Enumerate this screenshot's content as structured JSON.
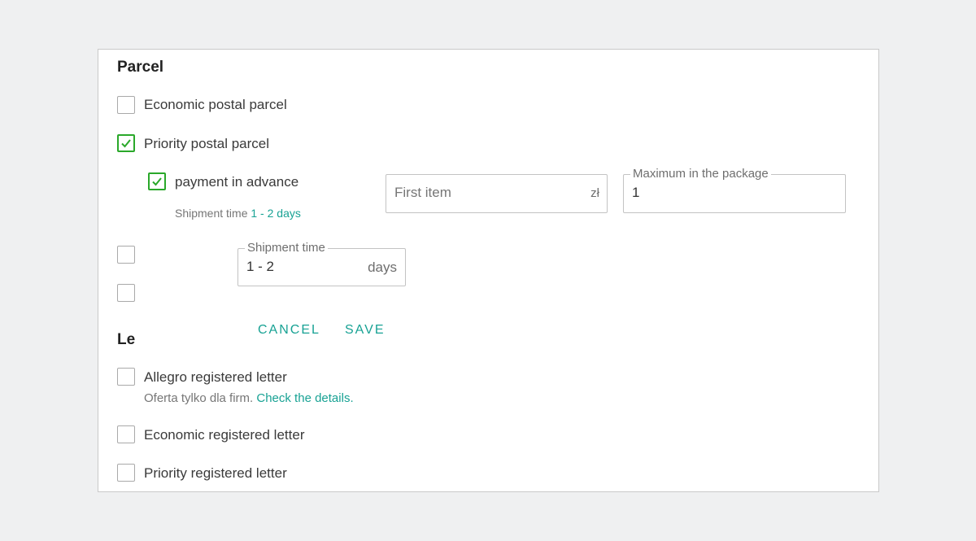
{
  "parcel": {
    "title": "Parcel",
    "economic_label": "Economic postal parcel",
    "priority_label": "Priority postal parcel",
    "advance_label": "payment in advance",
    "shipment_hint_prefix": "Shipment time",
    "shipment_hint_value": "1 - 2 days",
    "first_item_placeholder": "First item",
    "first_item_suffix": "zł",
    "max_package_legend": "Maximum in the package",
    "max_package_value": "1"
  },
  "popover": {
    "legend": "Shipment time",
    "value": "1 - 2",
    "suffix": "days",
    "cancel_label": "CANCEL",
    "save_label": "SAVE"
  },
  "letter": {
    "title_partial": "Le",
    "allegro_label": "Allegro registered letter",
    "allegro_hint": "Oferta tylko dla firm.",
    "allegro_link": "Check the details.",
    "economic_label": "Economic registered letter",
    "priority_label": "Priority registered letter"
  },
  "colors": {
    "accent": "#18a294",
    "check": "#2aa82a",
    "background": "#eff0f1"
  }
}
